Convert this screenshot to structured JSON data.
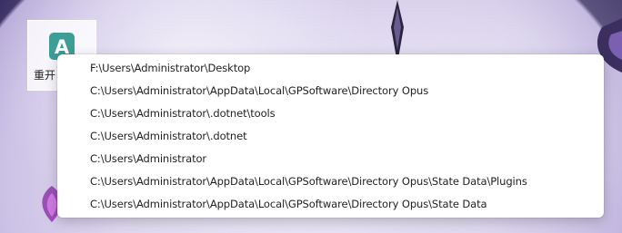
{
  "desktop": {
    "icon": {
      "glyph": "A",
      "glyph_name": "app-a-icon",
      "accent": "#3d9e96",
      "label": "重开"
    }
  },
  "recent_paths_menu": {
    "items": [
      "F:\\Users\\Administrator\\Desktop",
      "C:\\Users\\Administrator\\AppData\\Local\\GPSoftware\\Directory Opus",
      "C:\\Users\\Administrator\\.dotnet\\tools",
      "C:\\Users\\Administrator\\.dotnet",
      "C:\\Users\\Administrator",
      "C:\\Users\\Administrator\\AppData\\Local\\GPSoftware\\Directory Opus\\State Data\\Plugins",
      "C:\\Users\\Administrator\\AppData\\Local\\GPSoftware\\Directory Opus\\State Data"
    ]
  }
}
